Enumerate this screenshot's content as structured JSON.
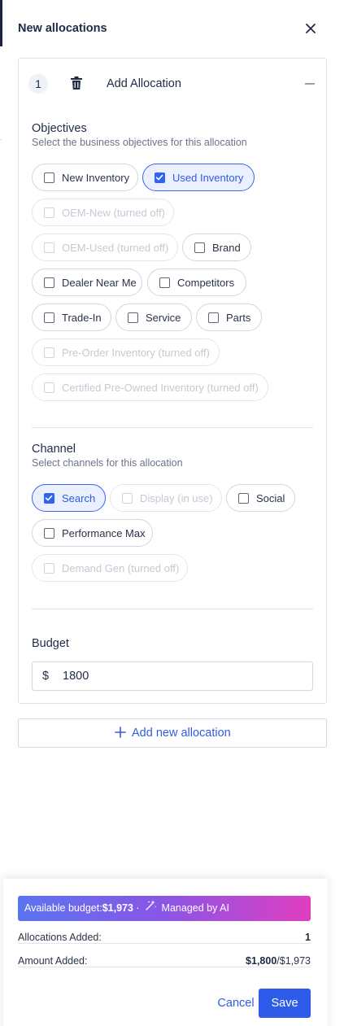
{
  "header": {
    "title": "New allocations"
  },
  "allocation": {
    "number": "1",
    "title": "Add Allocation",
    "objectives": {
      "title": "Objectives",
      "subtitle": "Select the business objectives for this allocation",
      "options": [
        {
          "label": "New Inventory",
          "checked": false,
          "disabled": false
        },
        {
          "label": "Used Inventory",
          "checked": true,
          "disabled": false
        },
        {
          "label": "OEM-New (turned off)",
          "checked": false,
          "disabled": true
        },
        {
          "label": "OEM-Used (turned off)",
          "checked": false,
          "disabled": true
        },
        {
          "label": "Brand",
          "checked": false,
          "disabled": false
        },
        {
          "label": "Dealer Near Me",
          "checked": false,
          "disabled": false
        },
        {
          "label": "Competitors",
          "checked": false,
          "disabled": false
        },
        {
          "label": "Trade-In",
          "checked": false,
          "disabled": false
        },
        {
          "label": "Service",
          "checked": false,
          "disabled": false
        },
        {
          "label": "Parts",
          "checked": false,
          "disabled": false
        },
        {
          "label": "Pre-Order Inventory (turned off)",
          "checked": false,
          "disabled": true
        },
        {
          "label": "Certified Pre-Owned Inventory (turned off)",
          "checked": false,
          "disabled": true
        }
      ]
    },
    "channel": {
      "title": "Channel",
      "subtitle": "Select channels for this allocation",
      "options": [
        {
          "label": "Search",
          "checked": true,
          "disabled": false
        },
        {
          "label": "Display (in use)",
          "checked": false,
          "disabled": true
        },
        {
          "label": "Social",
          "checked": false,
          "disabled": false
        },
        {
          "label": "Performance Max",
          "checked": false,
          "disabled": false
        },
        {
          "label": "Demand Gen (turned off)",
          "checked": false,
          "disabled": true
        }
      ]
    },
    "budget": {
      "title": "Budget",
      "currency": "$",
      "value": "1800"
    }
  },
  "add_new_label": "Add new allocation",
  "footer": {
    "banner_label": "Available budget:",
    "banner_amount": "$1,973",
    "banner_sep": "·",
    "banner_managed": "Managed by AI",
    "allocations_label": "Allocations Added:",
    "allocations_value": "1",
    "amount_label": "Amount Added:",
    "amount_value": "$1,800",
    "amount_total": "/$1,973",
    "cancel": "Cancel",
    "save": "Save"
  },
  "icons": {
    "close": "close-icon",
    "trash": "trash-icon",
    "collapse": "minus-icon",
    "plus": "plus-icon",
    "sparkle": "sparkle-icon",
    "check": "check-icon"
  },
  "colors": {
    "accent": "#2f5bea",
    "banner_start": "#5a74f0",
    "banner_end": "#e03fc0"
  }
}
